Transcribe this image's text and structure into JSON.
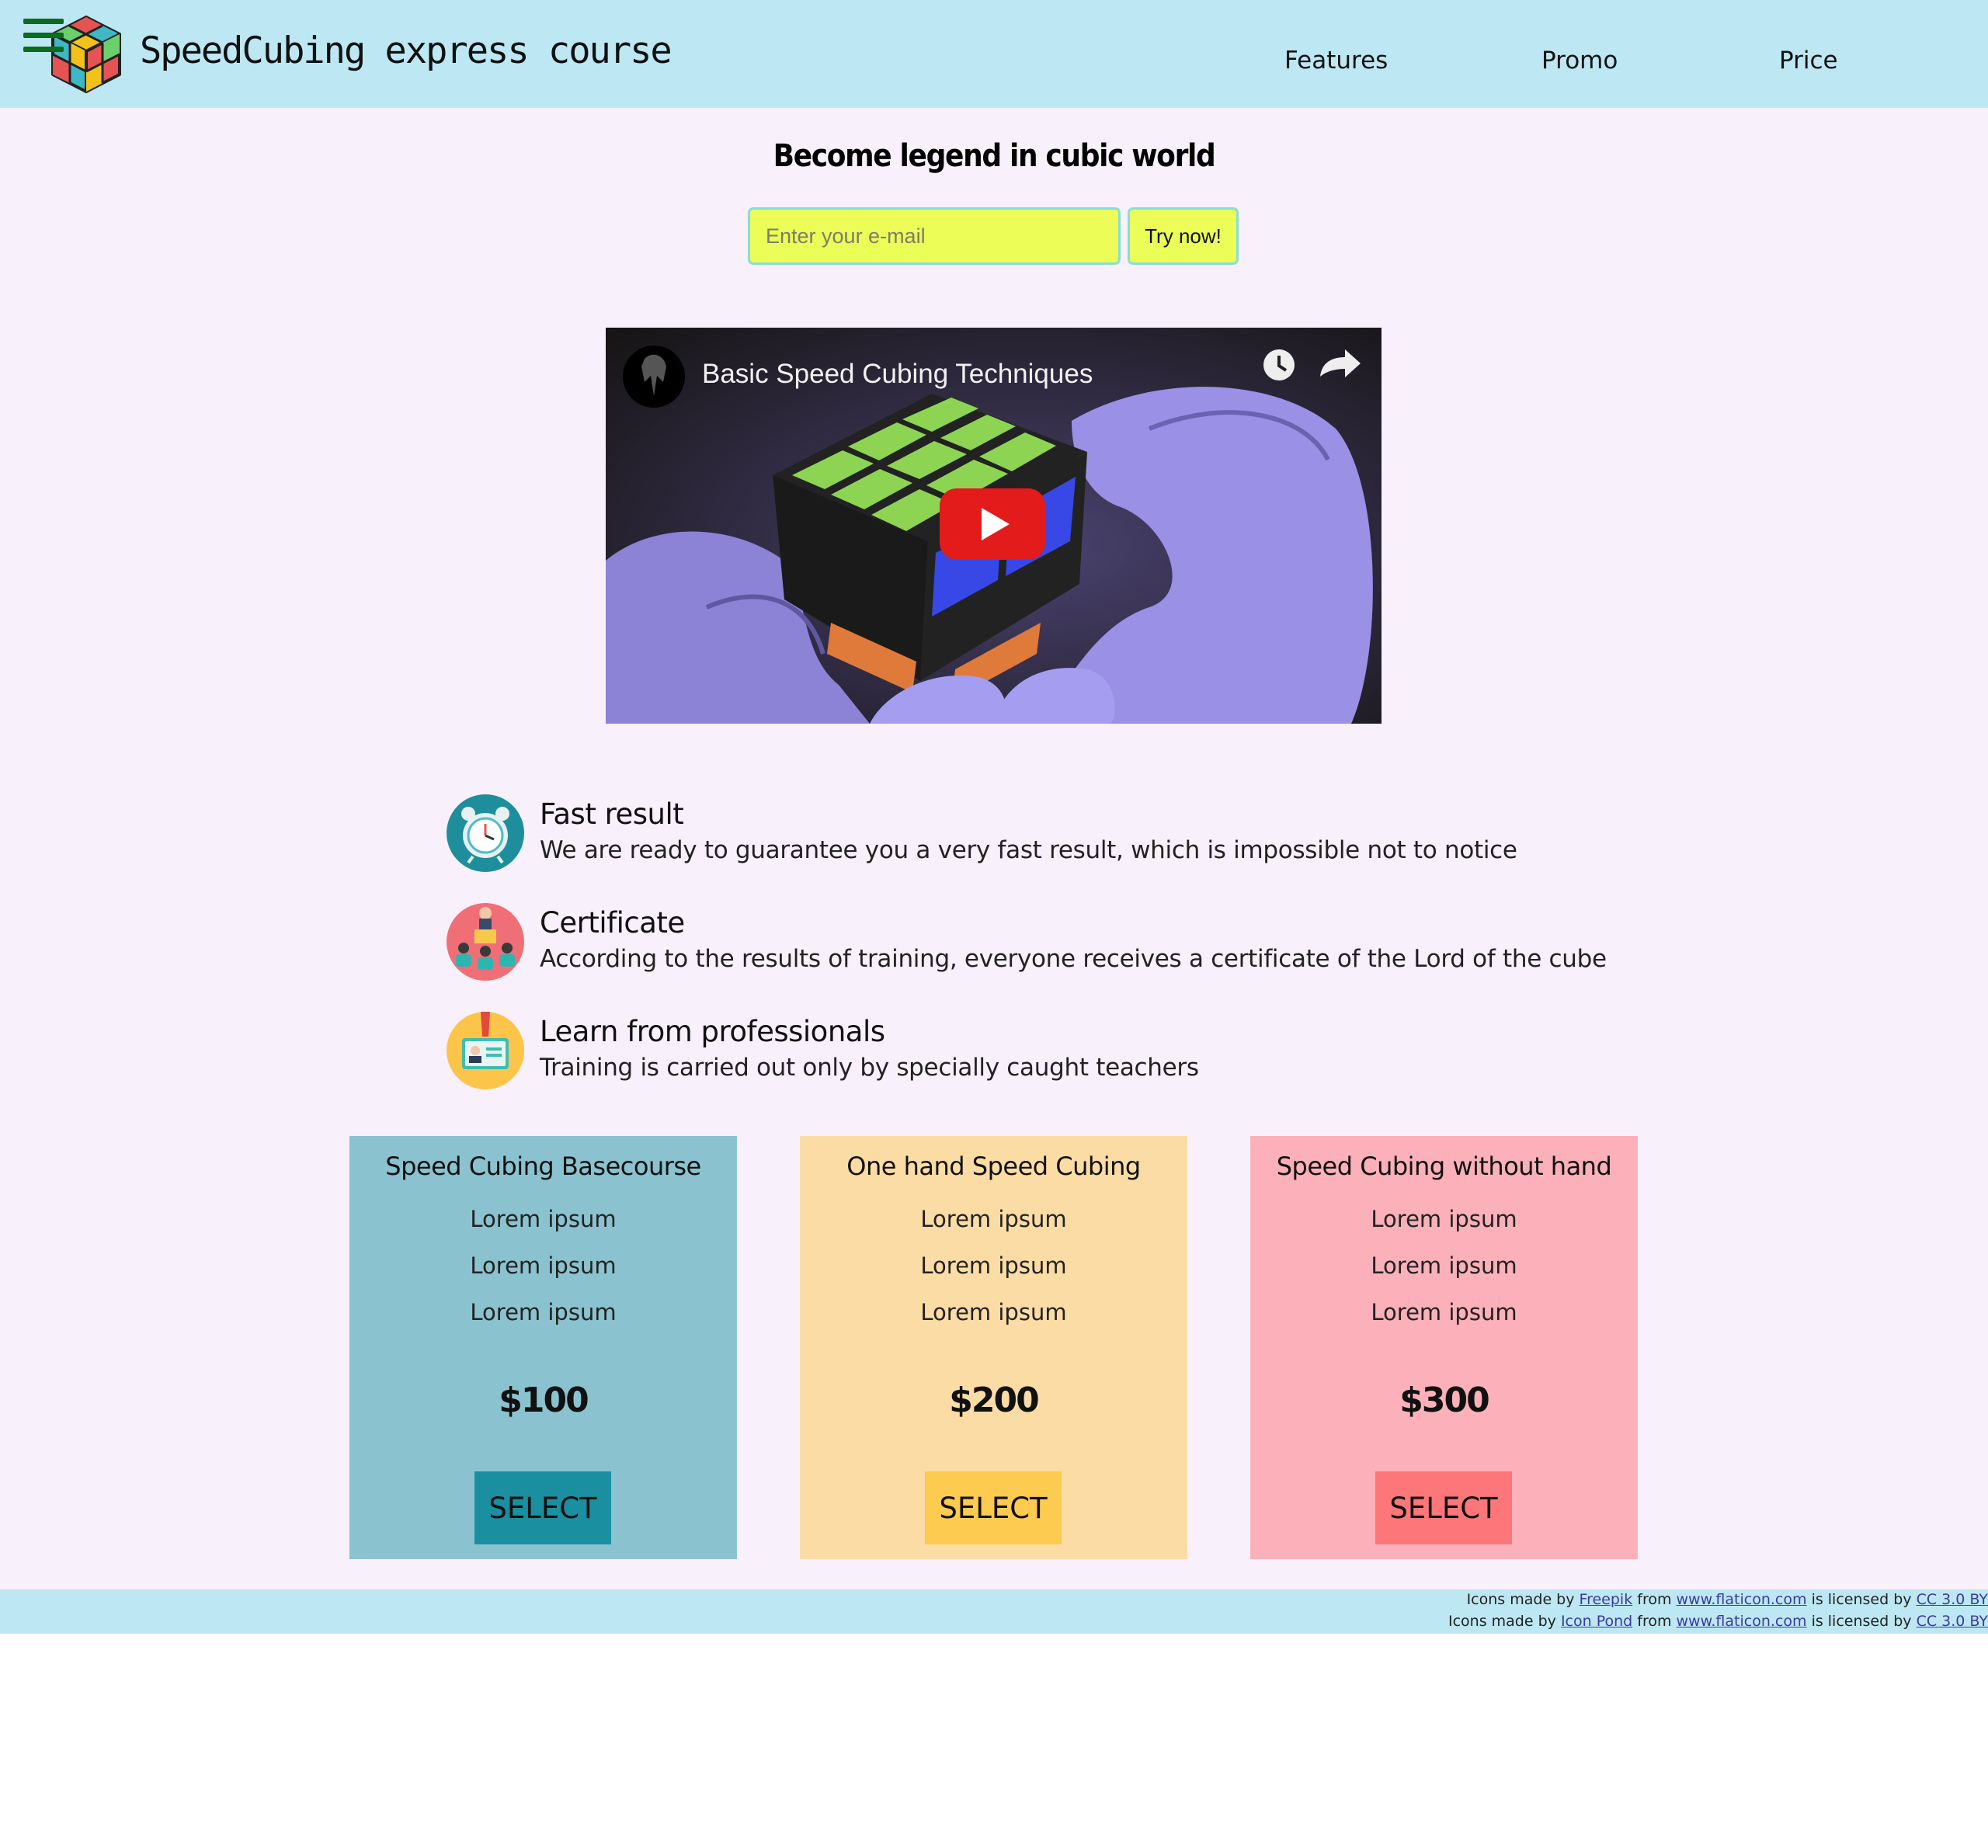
{
  "header": {
    "brand": "SpeedCubing express course",
    "nav": [
      "Features",
      "Promo",
      "Price"
    ]
  },
  "hero": {
    "title": "Become legend in cubic world",
    "email_placeholder": "Enter your e-mail",
    "try_label": "Try now!"
  },
  "video": {
    "title": "Basic Speed Cubing Techniques"
  },
  "features": [
    {
      "title": "Fast result",
      "text": "We are ready to guarantee you a very fast result, which is impossible not to notice",
      "icon": "alarm-clock-icon"
    },
    {
      "title": "Certificate",
      "text": "According to the results of training, everyone receives a certificate of the Lord of the cube",
      "icon": "teacher-audience-icon"
    },
    {
      "title": "Learn from professionals",
      "text": "Training is carried out only by specially caught teachers",
      "icon": "id-badge-icon"
    }
  ],
  "plans": [
    {
      "title": "Speed Cubing Basecourse",
      "features": [
        "Lorem ipsum",
        "Lorem ipsum",
        "Lorem ipsum"
      ],
      "price": "$100",
      "button": "SELECT"
    },
    {
      "title": "One hand Speed Cubing",
      "features": [
        "Lorem ipsum",
        "Lorem ipsum",
        "Lorem ipsum"
      ],
      "price": "$200",
      "button": "SELECT"
    },
    {
      "title": "Speed Cubing without hand",
      "features": [
        "Lorem ipsum",
        "Lorem ipsum",
        "Lorem ipsum"
      ],
      "price": "$300",
      "button": "SELECT"
    }
  ],
  "footer": {
    "credits": [
      {
        "prefix": "Icons made by",
        "author": "Freepik",
        "from": "from",
        "site": "www.flaticon.com",
        "licensed": "is licensed by",
        "license": "CC 3.0 BY"
      },
      {
        "prefix": "Icons made by",
        "author": "Icon Pond",
        "from": "from",
        "site": "www.flaticon.com",
        "licensed": "is licensed by",
        "license": "CC 3.0 BY"
      }
    ]
  },
  "colors": {
    "header_bg": "#bde8f3",
    "page_bg": "#f8f0fb",
    "input_bg": "#ebfd56",
    "plan1_bg": "#8ac3cf",
    "plan1_button": "#1a8f9f",
    "plan2_bg": "#fbdca5",
    "plan2_button": "#fdcb50",
    "plan3_bg": "#fbb0ba",
    "plan3_button": "#fd767a"
  }
}
